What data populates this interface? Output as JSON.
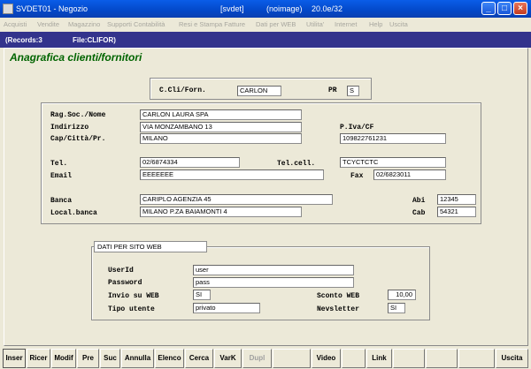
{
  "window": {
    "title": "SVDET01 - Negozio",
    "db": "[svdet]",
    "image": "(noimage)",
    "version": "20.0e/32"
  },
  "menu": [
    "Acquisti",
    "Vendite",
    "Magazzino",
    "Supporti Contabilità",
    "Resi e Stampa Fatture",
    "Dati per WEB",
    "Utilita'",
    "Internet",
    "Help",
    "Uscita"
  ],
  "info": {
    "records": "(Records:3",
    "file": "File:CLIFOR)"
  },
  "heading": "Anagrafica clienti/fornitori",
  "header_box": {
    "code_label": "C.Cli/Forn.",
    "code_value": "CARLON",
    "pr_label": "PR",
    "pr_value": "S"
  },
  "labels": {
    "ragsoc": "Rag.Soc./Nome",
    "indirizzo": "Indirizzo",
    "cap": "Cap/Città/Pr.",
    "piva": "P.Iva/CF",
    "tel": "Tel.",
    "telcell": "Tel.cell.",
    "email": "Email",
    "fax": "Fax",
    "banca": "Banca",
    "localbanca": "Local.banca",
    "abi": "Abi",
    "cab": "Cab"
  },
  "values": {
    "ragsoc": "CARLON LAURA SPA",
    "indirizzo": "VIA MONZAMBANO 13",
    "cap": "MILANO",
    "piva": "109822761231",
    "tel": "02/6874334",
    "telcell": "TCYCTCTC",
    "email": "EEEEEEE",
    "fax": "02/6823011",
    "banca": "CARIPLO AGENZIA 45",
    "localbanca": "MILANO P.ZA BAIAMONTI 4",
    "abi": "12345",
    "cab": "54321"
  },
  "web": {
    "legend": "DATI PER SITO WEB",
    "labels": {
      "userid": "UserId",
      "password": "Password",
      "invio": "Invio su WEB",
      "tipo": "Tipo utente",
      "sconto": "Sconto WEB",
      "newsletter": "Nevsletter"
    },
    "values": {
      "userid": "user",
      "password": "pass",
      "invio": "SI",
      "tipo": "privato",
      "sconto": "10,00",
      "newsletter": "SI"
    }
  },
  "toolbar": {
    "inser": "Inser",
    "ricer": "Ricer",
    "modif": "Modif",
    "pre": "Pre",
    "suc": "Suc",
    "annulla": "Annulla",
    "elenco": "Elenco",
    "cerca": "Cerca",
    "vark": "VarK",
    "dupl": "Dupl",
    "video": "Video",
    "link": "Link",
    "uscita": "Uscita"
  }
}
